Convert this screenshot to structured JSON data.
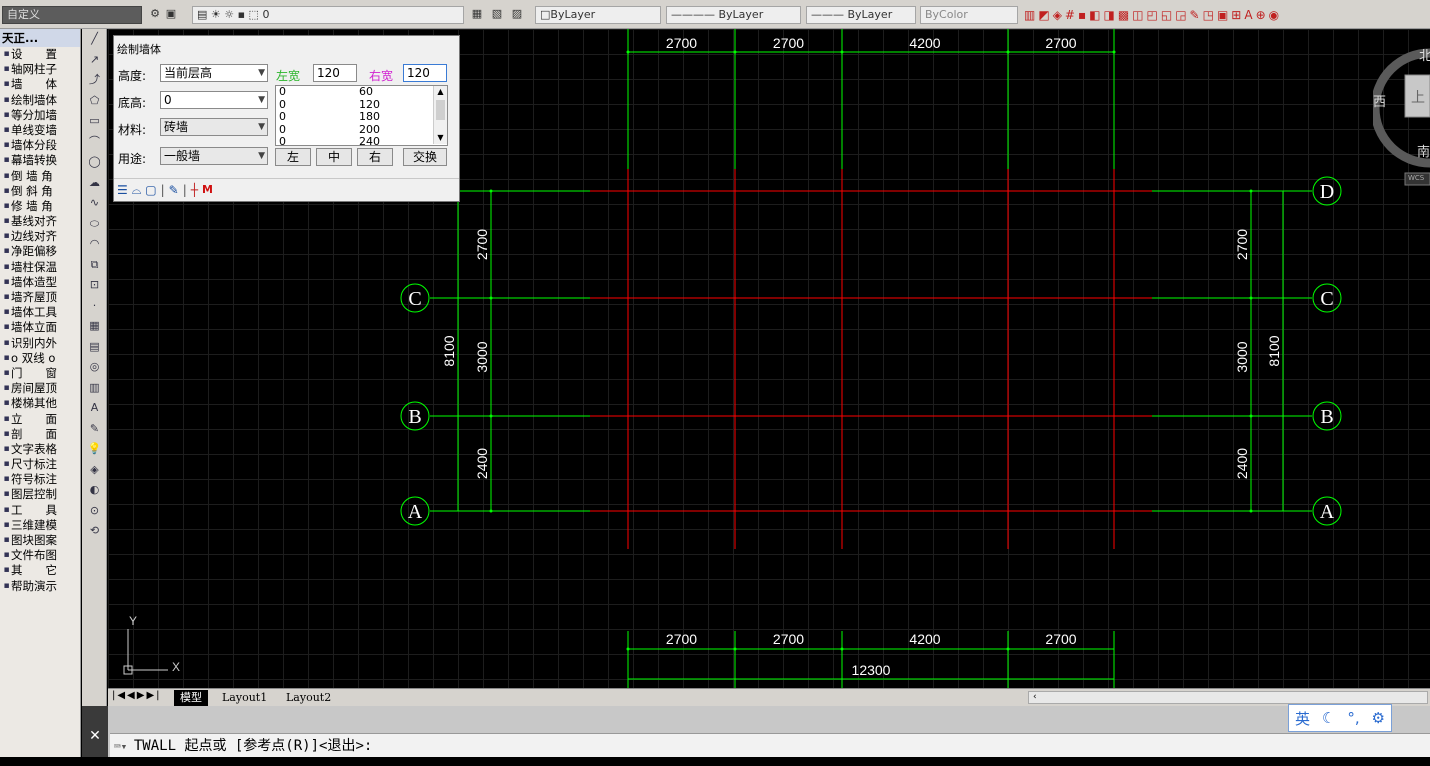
{
  "toolbar": {
    "workspace": "自定义",
    "layer_value": "0",
    "linetype_bylayer": "ByLayer",
    "lineweight_bylayer": "ByLayer",
    "color_bylayer": "ByLayer",
    "plot_bycolor": "ByColor"
  },
  "tianzheng_menu": {
    "title": "天正...",
    "items": [
      "设　　置",
      "轴网柱子",
      "墙　　体",
      "绘制墙体",
      "等分加墙",
      "单线变墙",
      "墙体分段",
      "幕墙转换",
      "倒 墙 角",
      "倒 斜 角",
      "修 墙 角",
      "基线对齐",
      "边线对齐",
      "净距偏移",
      "墙柱保温",
      "墙体造型",
      "墙齐屋顶",
      "墙体工具",
      "墙体立面",
      "识别内外",
      "o 双线 o",
      "门　　窗",
      "房间屋顶",
      "楼梯其他",
      "立　　面",
      "剖　　面",
      "文字表格",
      "尺寸标注",
      "符号标注",
      "图层控制",
      "工　　具",
      "三维建模",
      "图块图案",
      "文件布图",
      "其　　它",
      "帮助演示"
    ]
  },
  "dialog": {
    "title": "绘制墙体",
    "height_label": "高度:",
    "height_value": "当前层高",
    "base_label": "底高:",
    "base_value": "0",
    "material_label": "材料:",
    "material_value": "砖墙",
    "usage_label": "用途:",
    "usage_value": "一般墙",
    "left_width_label": "左宽",
    "left_width_value": "120",
    "right_width_label": "右宽",
    "right_width_value": "120",
    "width_list": [
      [
        "0",
        "60"
      ],
      [
        "0",
        "120"
      ],
      [
        "0",
        "180"
      ],
      [
        "0",
        "200"
      ],
      [
        "0",
        "240"
      ]
    ],
    "btn_left": "左",
    "btn_center": "中",
    "btn_right": "右",
    "btn_swap": "交换",
    "mode_letter": "M",
    "colors": {
      "left_width": "#2cb52c",
      "right_width": "#d020d0"
    }
  },
  "drawing": {
    "top_dims": [
      "2700",
      "2700",
      "4200",
      "2700"
    ],
    "bottom_dims": [
      "2700",
      "2700",
      "4200",
      "2700"
    ],
    "bottom_total": "12300",
    "left_dims": [
      "2700",
      "3000",
      "2400"
    ],
    "left_total": "8100",
    "right_dims": [
      "2700",
      "3000",
      "2400"
    ],
    "right_total": "8100",
    "axis_labels": [
      "D",
      "C",
      "B",
      "A"
    ],
    "ucs_x": "X",
    "ucs_y": "Y",
    "colors": {
      "grid_axis": "#00ff00",
      "wall_axis": "#ff0000",
      "dim_text": "#ffffff"
    }
  },
  "viewcube": {
    "north": "北",
    "west": "西",
    "south": "南",
    "top": "上",
    "wcs": "WCS"
  },
  "tabs": {
    "model": "模型",
    "layout1": "Layout1",
    "layout2": "Layout2"
  },
  "command": {
    "text": "TWALL 起点或 [参考点(R)]<退出>:"
  },
  "ime": {
    "lang": "英"
  }
}
